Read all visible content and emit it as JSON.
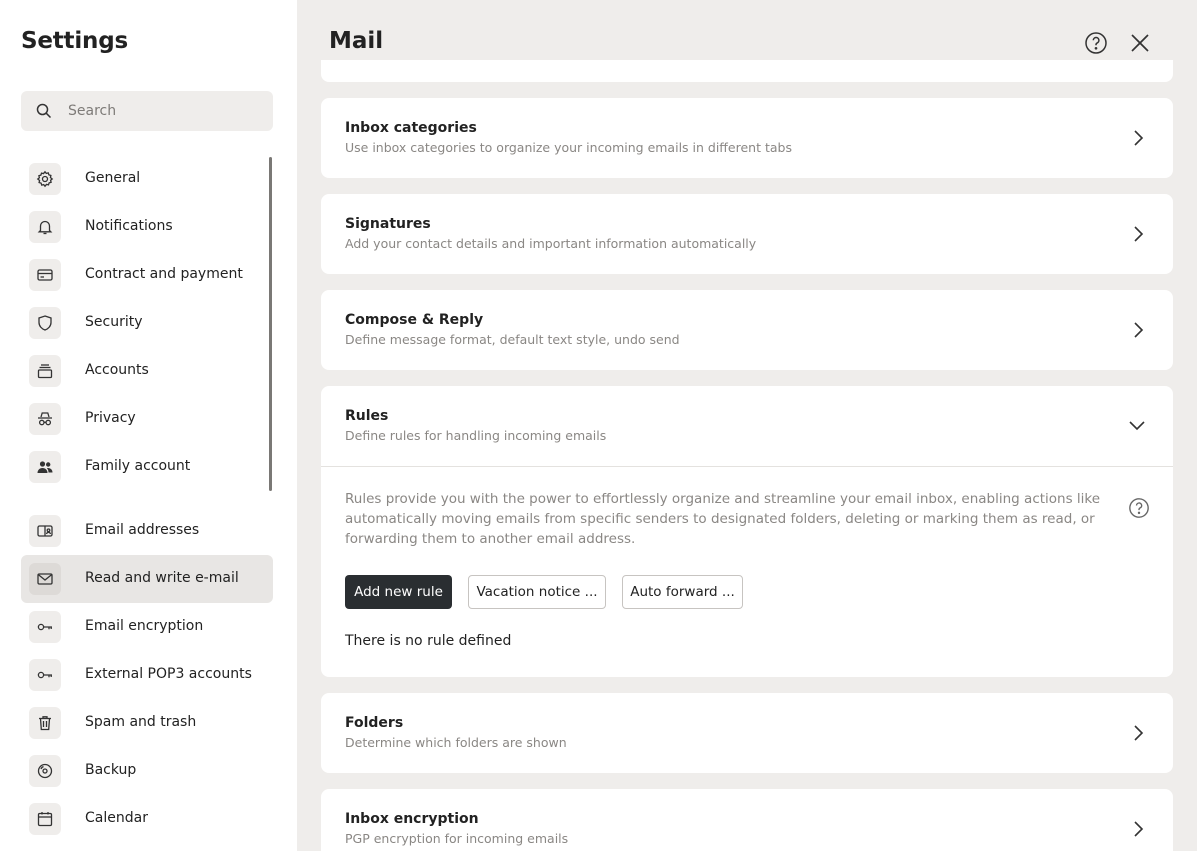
{
  "sidebar": {
    "title": "Settings",
    "search_placeholder": "Search",
    "items": [
      {
        "label": "General",
        "icon": "gear-icon"
      },
      {
        "label": "Notifications",
        "icon": "bell-icon"
      },
      {
        "label": "Contract and payment",
        "icon": "credit-card-icon"
      },
      {
        "label": "Security",
        "icon": "shield-icon"
      },
      {
        "label": "Accounts",
        "icon": "stack-icon"
      },
      {
        "label": "Privacy",
        "icon": "incognito-icon"
      },
      {
        "label": "Family account",
        "icon": "people-icon"
      },
      {
        "label": "Email addresses",
        "icon": "id-card-icon"
      },
      {
        "label": "Read and write e-mail",
        "icon": "envelope-icon",
        "active": true
      },
      {
        "label": "Email encryption",
        "icon": "key-icon"
      },
      {
        "label": "External POP3 accounts",
        "icon": "key-icon"
      },
      {
        "label": "Spam and trash",
        "icon": "trash-icon"
      },
      {
        "label": "Backup",
        "icon": "disc-icon"
      },
      {
        "label": "Calendar",
        "icon": "calendar-icon"
      }
    ]
  },
  "main": {
    "title": "Mail",
    "cards": {
      "inbox_categories": {
        "title": "Inbox categories",
        "desc": "Use inbox categories to organize your incoming emails in different tabs"
      },
      "signatures": {
        "title": "Signatures",
        "desc": "Add your contact details and important information automatically"
      },
      "compose": {
        "title": "Compose & Reply",
        "desc": "Define message format, default text style, undo send"
      },
      "rules": {
        "title": "Rules",
        "desc": "Define rules for handling incoming emails",
        "explanation": "Rules provide you with the power to effortlessly organize and streamline your email inbox, enabling actions like automatically moving emails from specific senders to designated folders, deleting or marking them as read, or forwarding them to another email address.",
        "add_rule_label": "Add new rule",
        "vacation_label": "Vacation notice ...",
        "forward_label": "Auto forward ...",
        "empty_text": "There is no rule defined"
      },
      "folders": {
        "title": "Folders",
        "desc": "Determine which folders are shown"
      },
      "inbox_encryption": {
        "title": "Inbox encryption",
        "desc": "PGP encryption for incoming emails"
      }
    }
  }
}
